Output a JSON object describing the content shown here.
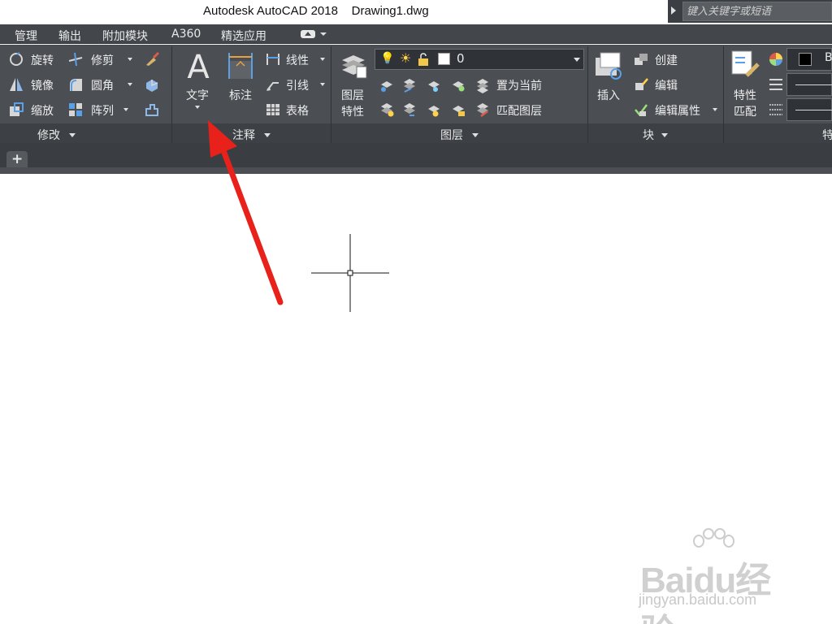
{
  "title_bar": {
    "title": "Autodesk AutoCAD 2018    Drawing1.dwg"
  },
  "search": {
    "placeholder": "键入关键字或短语"
  },
  "menu_tabs": [
    "管理",
    "输出",
    "附加模块",
    "A360",
    "精选应用"
  ],
  "ribbon": {
    "modify": {
      "title": "修改",
      "tools": {
        "rotate": "旋转",
        "trim": "修剪",
        "mirror": "镜像",
        "fillet": "圆角",
        "scale": "缩放",
        "array": "阵列"
      }
    },
    "annotation": {
      "title": "注释",
      "text": "文字",
      "dimension": "标注",
      "linear": "线性",
      "leader": "引线",
      "table": "表格"
    },
    "layers": {
      "title": "图层",
      "properties": [
        "图层",
        "特性"
      ],
      "current_layer": "0",
      "make_current": "置为当前",
      "match_layer": "匹配图层"
    },
    "block": {
      "title": "块",
      "insert": "插入",
      "create": "创建",
      "edit": "编辑",
      "edit_attributes": "编辑属性"
    },
    "properties": {
      "title": "特",
      "match": [
        "特性",
        "匹配"
      ],
      "color_value": "B"
    }
  },
  "colors": {
    "ribbon_bg": "#4b4f54",
    "panel_bar": "#3d4145",
    "annotation_arrow": "#e8211a"
  },
  "watermark": {
    "logo": "Baidu经验",
    "url": "jingyan.baidu.com"
  }
}
